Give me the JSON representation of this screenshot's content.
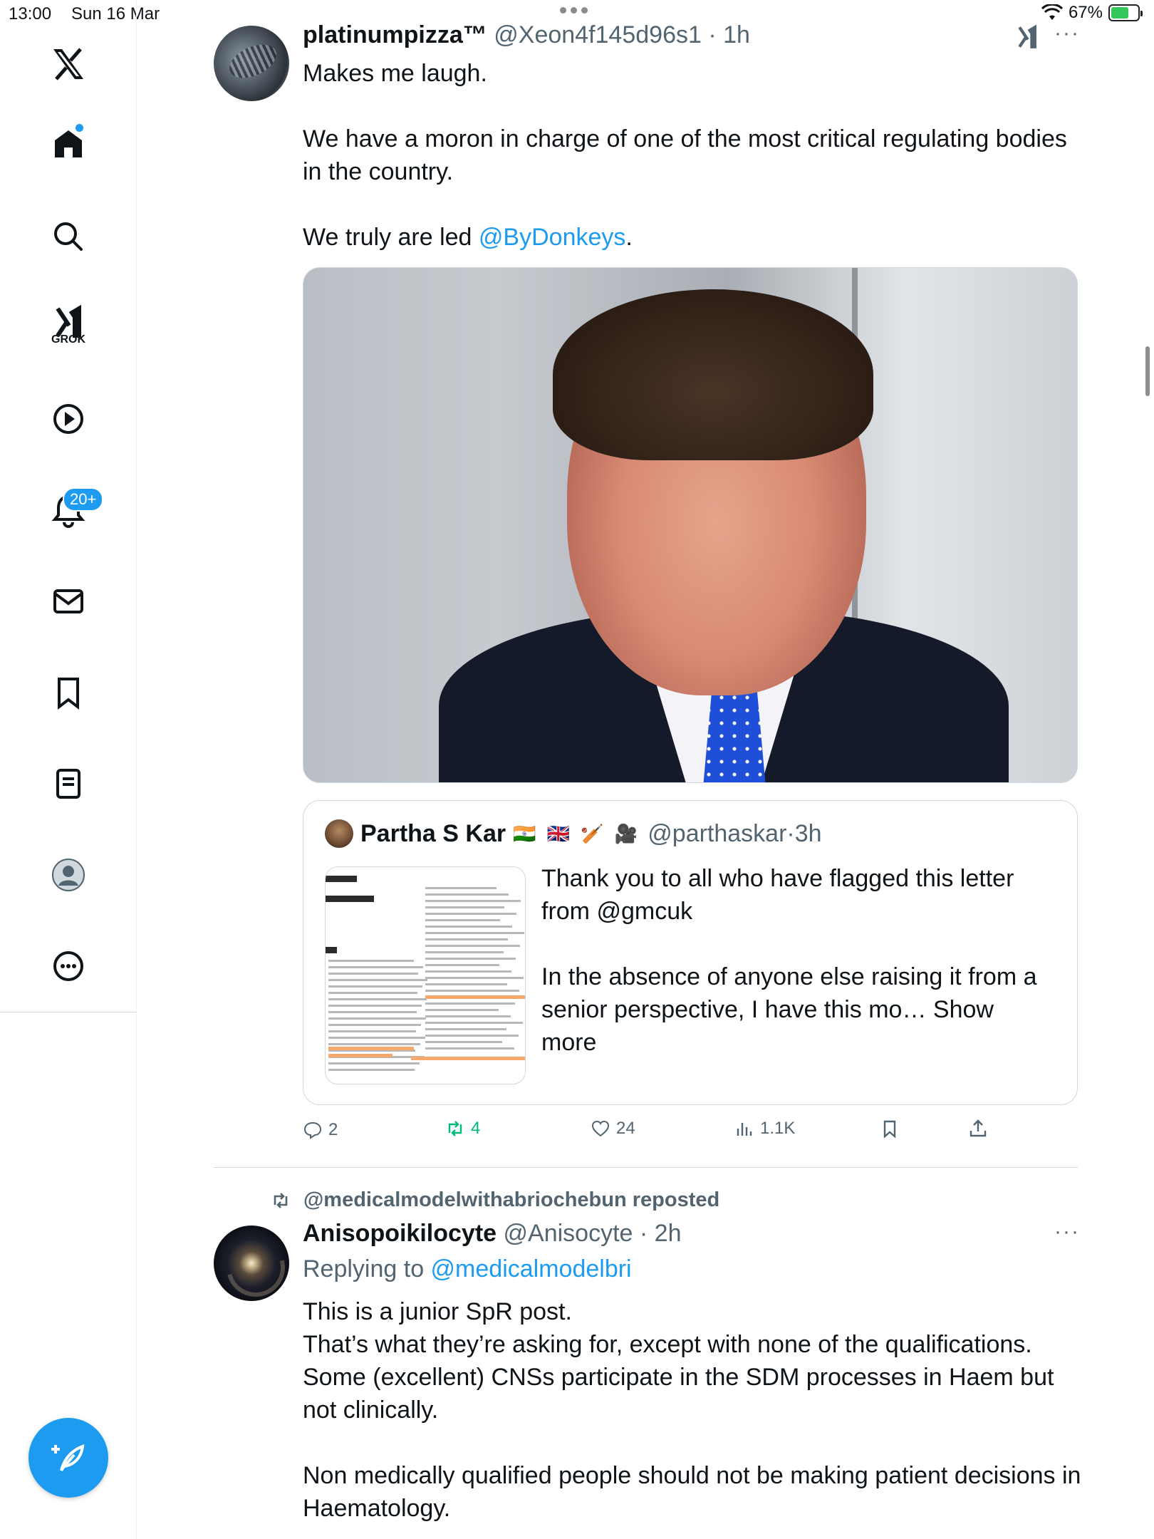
{
  "status_bar": {
    "time": "13:00",
    "date": "Sun 16 Mar",
    "battery": "67%",
    "battery_level": 0.67
  },
  "sidebar": {
    "items": [
      {
        "name": "x-logo-icon"
      },
      {
        "name": "home-icon"
      },
      {
        "name": "search-icon"
      },
      {
        "name": "grok-icon",
        "label": "GROK"
      },
      {
        "name": "video-icon"
      },
      {
        "name": "notifications-icon",
        "badge": "20+"
      },
      {
        "name": "messages-icon"
      },
      {
        "name": "bookmarks-icon"
      },
      {
        "name": "lists-icon"
      },
      {
        "name": "profile-icon"
      },
      {
        "name": "more-icon"
      }
    ],
    "compose": "compose-icon"
  },
  "tweet1": {
    "display_name": "platinumpizza™",
    "handle": "@Xeon4f145d96s1",
    "time": "1h",
    "text_p1": "Makes me laugh.",
    "text_p2": "We have a moron in charge of one of the most critical regulating bodies in the country.",
    "text_p3_prefix": "We truly are led ",
    "text_p3_link": "@ByDonkeys",
    "text_p3_suffix": ".",
    "quote": {
      "display_name": "Partha S Kar",
      "emojis": "🇮🇳 🇬🇧 🏏 🎥",
      "handle": "@parthaskar",
      "time": "3h",
      "text_p1": "Thank you to all who have flagged this letter from @gmcuk",
      "text_p2": "In the absence of anyone else raising it from a senior perspective, I have this mo…",
      "show_more": "Show more"
    },
    "actions": {
      "replies": "2",
      "reposts": "4",
      "likes": "24",
      "views": "1.1K"
    }
  },
  "tweet2": {
    "repost_by": "@medicalmodelwithabriochebun reposted",
    "display_name": "Anisopoikilocyte",
    "handle": "@Anisocyte",
    "time": "2h",
    "reply_prefix": "Replying to ",
    "reply_handle": "@medicalmodelbri",
    "line1": "This is a junior SpR post.",
    "line2": "That’s what they’re asking for, except with none of the qualifications.",
    "line3": "Some (excellent) CNSs participate in the SDM processes in Haem but not clinically.",
    "line4": "Non medically qualified people should not be making patient decisions in Haematology."
  },
  "colors": {
    "accent": "#1d9bf0",
    "muted": "#536471",
    "repost_green": "#00ba7c"
  }
}
